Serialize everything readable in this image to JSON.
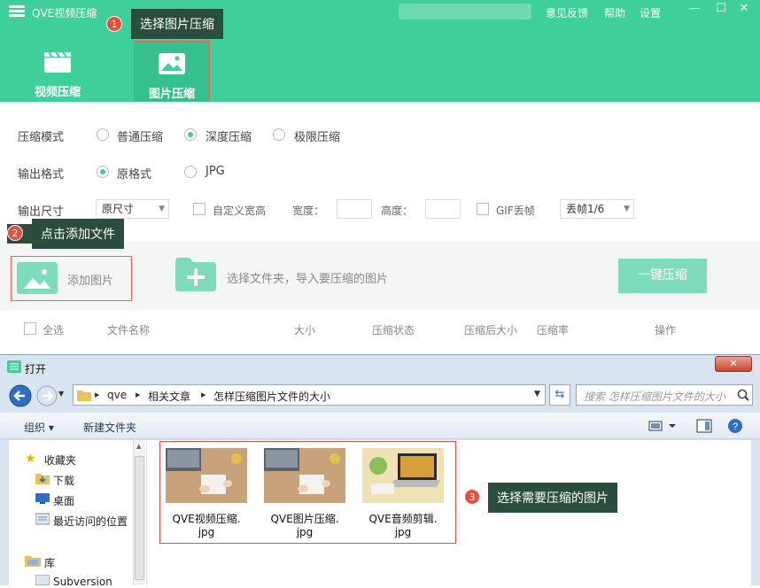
{
  "app": {
    "title": "QVE视频压缩",
    "menu": [
      "意见反馈",
      "帮助",
      "设置"
    ],
    "win_buttons": [
      "—",
      "☐",
      "✕"
    ]
  },
  "tabs": [
    {
      "label": "视频压缩",
      "icon": "video-icon"
    },
    {
      "label": "图片压缩",
      "icon": "image-icon"
    }
  ],
  "callouts": [
    {
      "num": "1",
      "text": "选择图片压缩"
    },
    {
      "num": "2",
      "text": "点击添加文件"
    },
    {
      "num": "3",
      "text": "选择需要压缩的图片"
    }
  ],
  "settings": {
    "mode_label": "压缩模式",
    "modes": [
      "普通压缩",
      "深度压缩",
      "极限压缩"
    ],
    "mode_selected": "深度压缩",
    "format_label": "输出格式",
    "formats": [
      "原格式",
      "JPG"
    ],
    "format_selected": "原格式",
    "size_label": "输出尺寸",
    "size_value": "原尺寸",
    "custom_wh": "自定义宽高",
    "width_label": "宽度：",
    "height_label": "高度：",
    "gif_drop": "GIF丢帧",
    "gif_value": "丢帧1/6"
  },
  "addbar": {
    "add_image": "添加图片",
    "folder_hint": "选择文件夹，导入要压缩的图片",
    "compress_btn": "一键压缩"
  },
  "columns": [
    "全选",
    "文件名称",
    "大小",
    "压缩状态",
    "压缩后大小",
    "压缩率",
    "操作"
  ],
  "dialog": {
    "title": "打开",
    "close": "✕",
    "crumbs": [
      "qve",
      "相关文章",
      "怎样压缩图片文件的大小"
    ],
    "search_placeholder": "搜索 怎样压缩图片文件的大小",
    "toolbar": {
      "organize": "组织 ▾",
      "new_folder": "新建文件夹"
    },
    "nav": {
      "favorites": "收藏夹",
      "items": [
        "下载",
        "桌面",
        "最近访问的位置"
      ],
      "library": "库",
      "library_items": [
        "Subversion"
      ]
    },
    "files": [
      {
        "name1": "QVE视频压缩.",
        "name2": "jpg"
      },
      {
        "name1": "QVE图片压缩.",
        "name2": "jpg"
      },
      {
        "name1": "QVE音频剪辑.",
        "name2": "jpg"
      }
    ]
  },
  "colors": {
    "accent": "#3ecf9a",
    "callout_bg": "#2a4d3e",
    "badge": "#e84c3d",
    "highlight": "#ff5959"
  }
}
